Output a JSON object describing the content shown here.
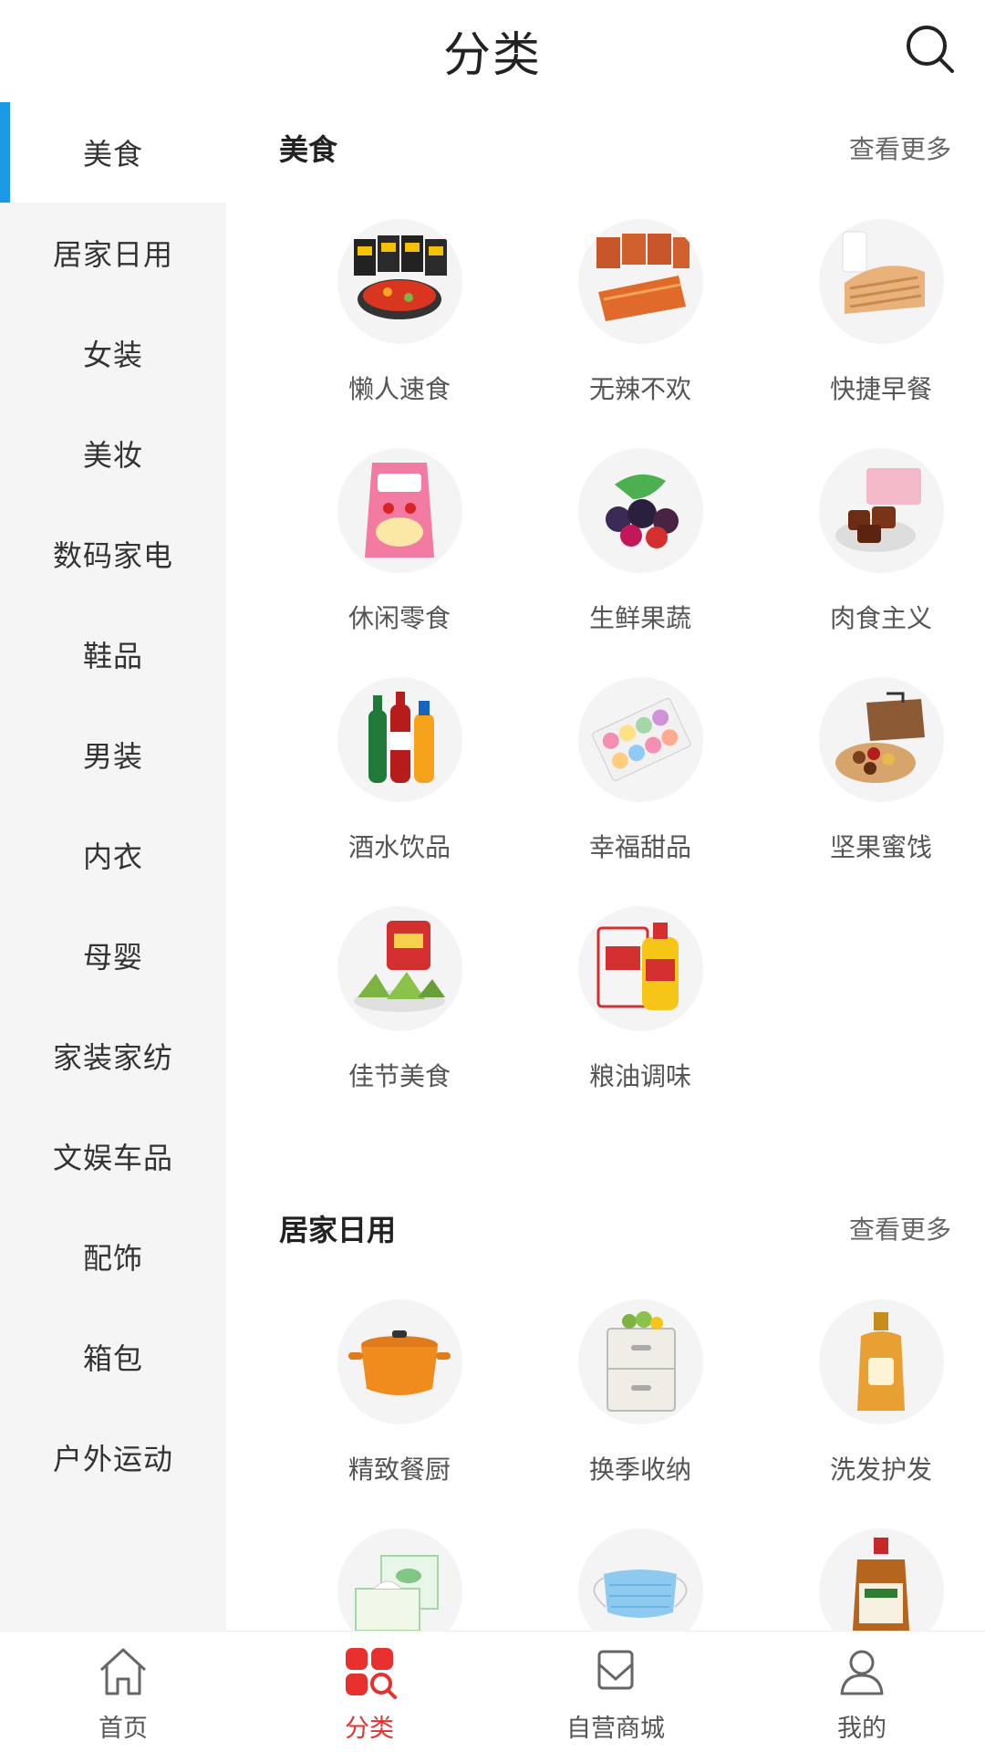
{
  "header": {
    "title": "分类",
    "search_icon": "search-icon"
  },
  "sidebar": {
    "active_index": 0,
    "accent_color": "#1a9ae6",
    "items": [
      {
        "label": "美食"
      },
      {
        "label": "居家日用"
      },
      {
        "label": "女装"
      },
      {
        "label": "美妆"
      },
      {
        "label": "数码家电"
      },
      {
        "label": "鞋品"
      },
      {
        "label": "男装"
      },
      {
        "label": "内衣"
      },
      {
        "label": "母婴"
      },
      {
        "label": "家装家纺"
      },
      {
        "label": "文娱车品"
      },
      {
        "label": "配饰"
      },
      {
        "label": "箱包"
      },
      {
        "label": "户外运动"
      }
    ]
  },
  "sections": [
    {
      "title": "美食",
      "more": "查看更多",
      "items": [
        {
          "label": "懒人速食",
          "icon": "instant-noodles-image"
        },
        {
          "label": "无辣不欢",
          "icon": "spicy-strips-image"
        },
        {
          "label": "快捷早餐",
          "icon": "bread-milk-image"
        },
        {
          "label": "休闲零食",
          "icon": "snack-bag-image"
        },
        {
          "label": "生鲜果蔬",
          "icon": "berries-image"
        },
        {
          "label": "肉食主义",
          "icon": "braised-meat-image"
        },
        {
          "label": "酒水饮品",
          "icon": "drink-bottles-image"
        },
        {
          "label": "幸福甜品",
          "icon": "macarons-image"
        },
        {
          "label": "坚果蜜饯",
          "icon": "nuts-box-image"
        },
        {
          "label": "佳节美食",
          "icon": "zongzi-image"
        },
        {
          "label": "粮油调味",
          "icon": "rice-oil-image"
        }
      ]
    },
    {
      "title": "居家日用",
      "more": "查看更多",
      "items": [
        {
          "label": "精致餐厨",
          "icon": "cooking-pot-image"
        },
        {
          "label": "换季收纳",
          "icon": "storage-drawers-image"
        },
        {
          "label": "洗发护发",
          "icon": "shampoo-bottle-image"
        },
        {
          "label": "",
          "icon": "tissue-box-image"
        },
        {
          "label": "",
          "icon": "face-mask-image"
        },
        {
          "label": "",
          "icon": "disinfectant-bottle-image"
        }
      ]
    }
  ],
  "tabbar": {
    "active_index": 1,
    "active_color": "#e8302e",
    "tabs": [
      {
        "label": "首页",
        "icon": "home-icon"
      },
      {
        "label": "分类",
        "icon": "category-icon"
      },
      {
        "label": "自营商城",
        "icon": "store-icon"
      },
      {
        "label": "我的",
        "icon": "profile-icon"
      }
    ]
  }
}
